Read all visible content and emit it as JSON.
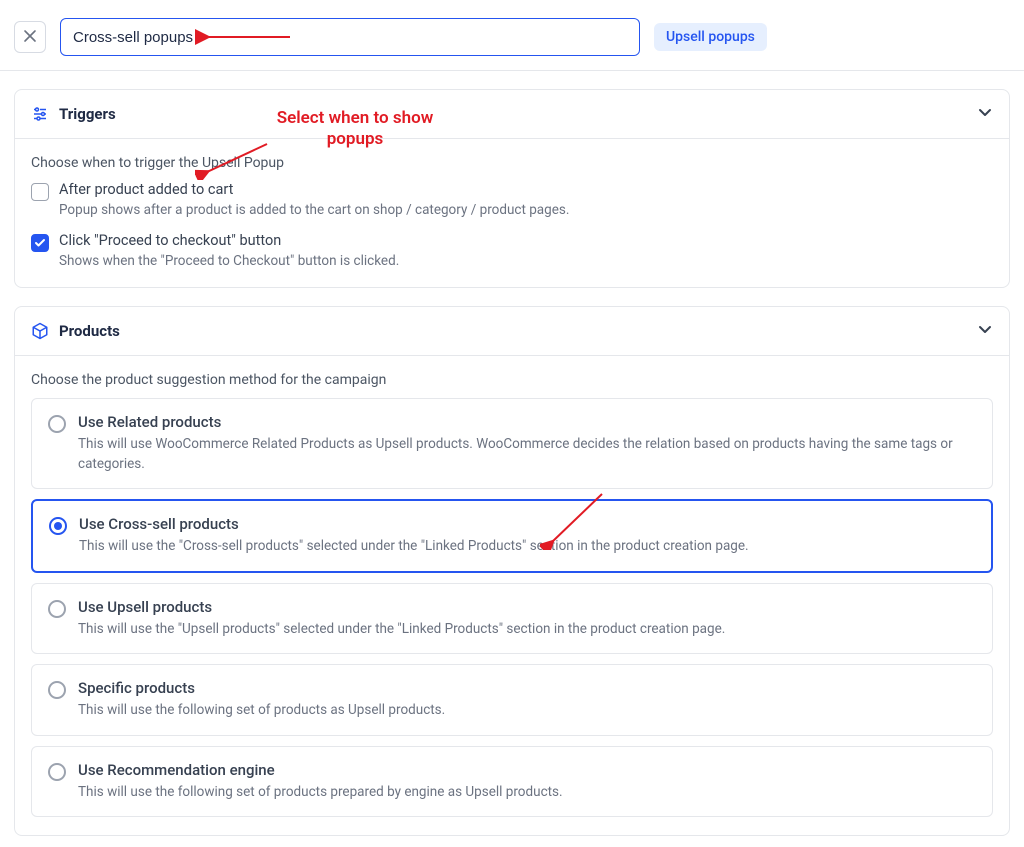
{
  "header": {
    "title_value": "Cross-sell popups",
    "tag": "Upsell popups"
  },
  "annotation": {
    "label": "Select when to show popups"
  },
  "triggers": {
    "title": "Triggers",
    "instruction": "Choose when to trigger the Upsell Popup",
    "items": [
      {
        "label": "After product added to cart",
        "desc": "Popup shows after a product is added to the cart on shop / category / product pages.",
        "checked": false
      },
      {
        "label": "Click \"Proceed to checkout\" button",
        "desc": "Shows when the \"Proceed to Checkout\" button is clicked.",
        "checked": true
      }
    ]
  },
  "products": {
    "title": "Products",
    "instruction": "Choose the product suggestion method for the campaign",
    "options": [
      {
        "label": "Use Related products",
        "desc": "This will use WooCommerce Related Products as Upsell products.\nWooCommerce decides the relation based on products having the same tags or categories.",
        "selected": false
      },
      {
        "label": "Use Cross-sell products",
        "desc": "This will use the \"Cross-sell products\" selected under the \"Linked Products\" section in the product creation page.",
        "selected": true
      },
      {
        "label": "Use Upsell products",
        "desc": "This will use the \"Upsell products\" selected under the \"Linked Products\" section in the product creation page.",
        "selected": false
      },
      {
        "label": "Specific products",
        "desc": "This will use the following set of products as Upsell products.",
        "selected": false
      },
      {
        "label": "Use Recommendation engine",
        "desc": "This will use the following set of products prepared by engine as Upsell products.",
        "selected": false
      }
    ]
  }
}
